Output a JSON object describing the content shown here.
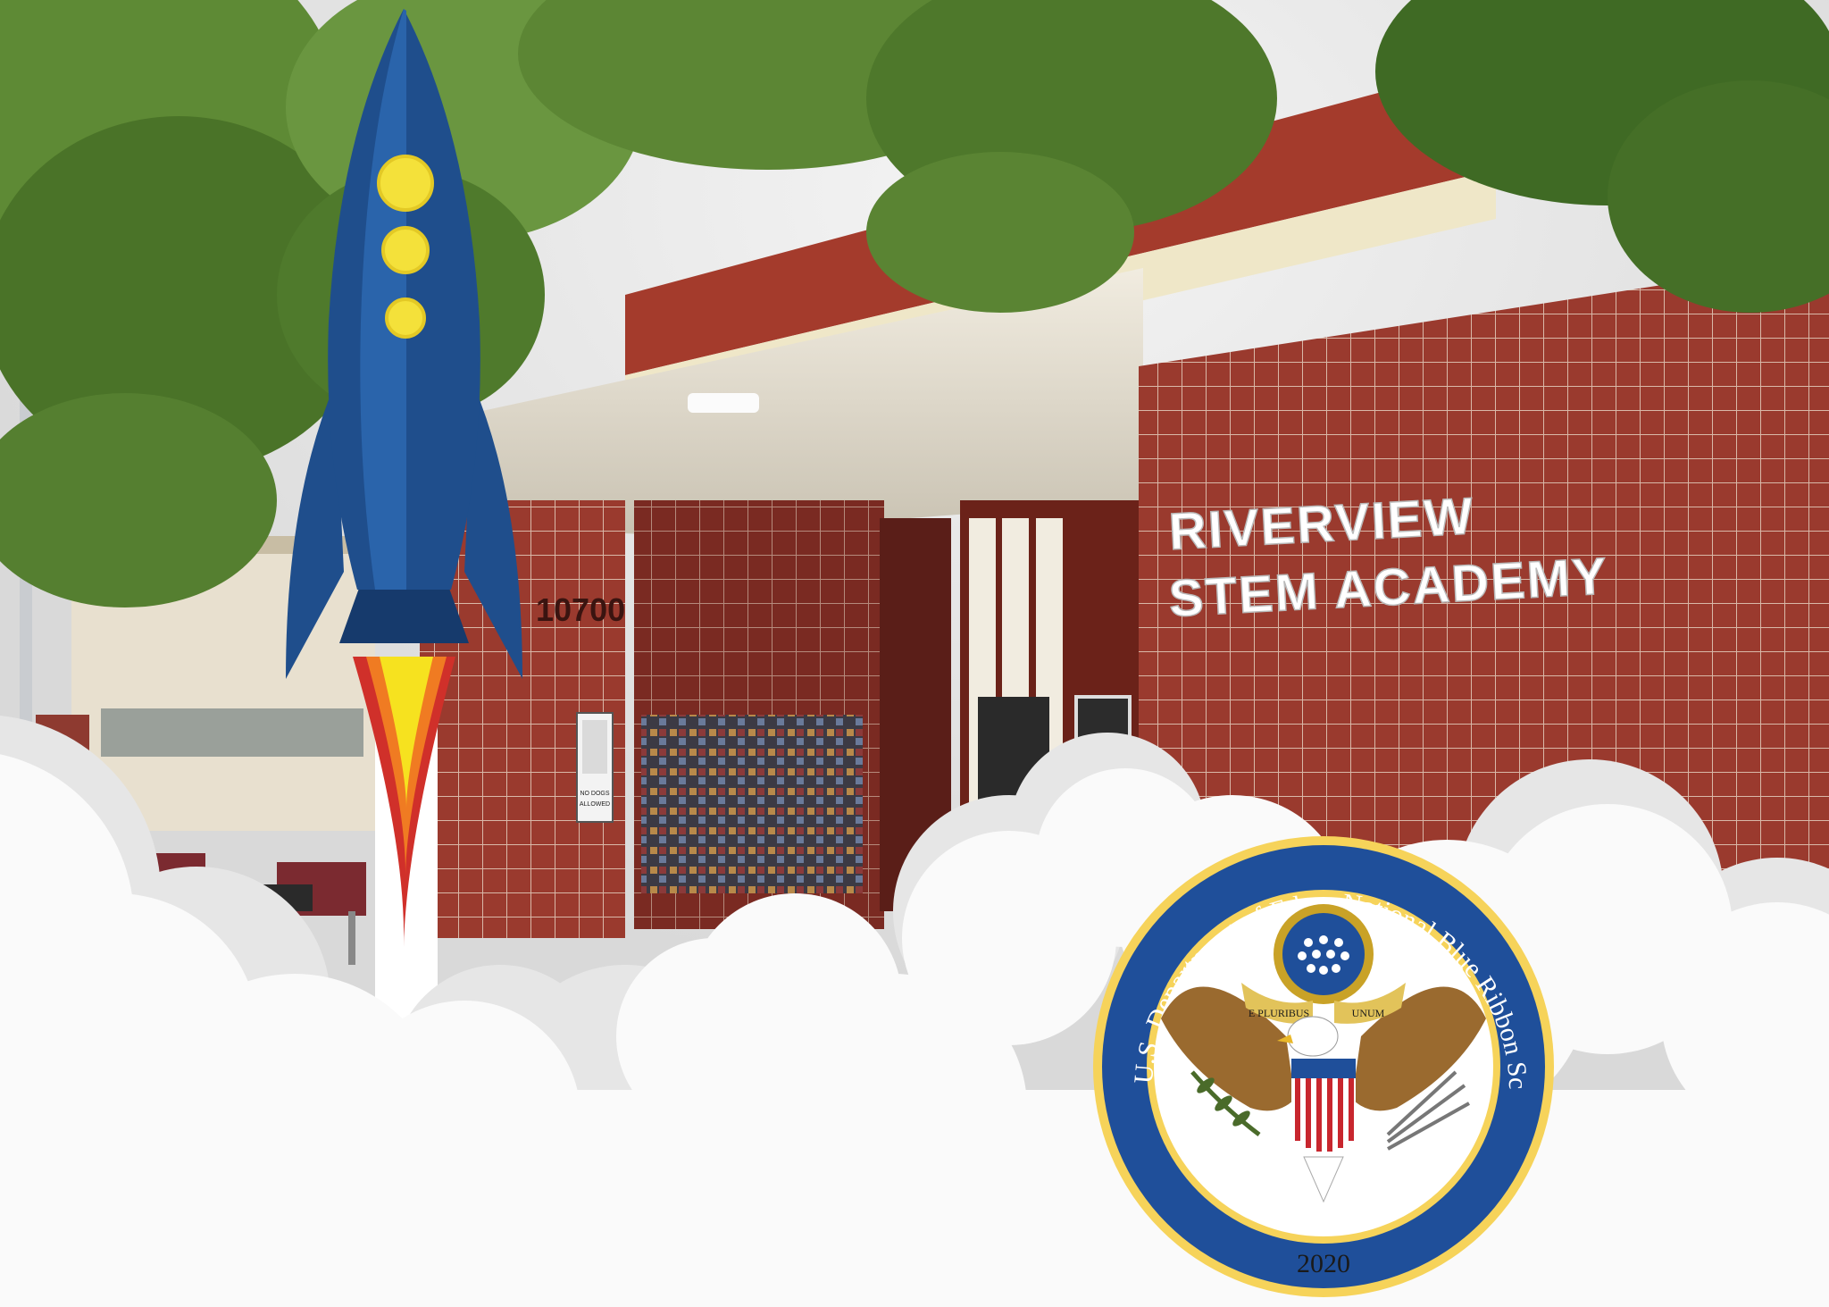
{
  "building": {
    "sign_line_1": "RIVERVIEW",
    "sign_line_2": "STEM ACADEMY",
    "address_number": "10700",
    "door_sign_line_1": "NO DOGS",
    "door_sign_line_2": "ALLOWED"
  },
  "seal": {
    "ring_text_left": "U.S. Department of Education",
    "ring_text_right": "National Blue Ribbon School",
    "motto_left": "E PLURIBUS",
    "motto_right": "UNUM",
    "year": "2020"
  },
  "colors": {
    "brick": "#9a3a2e",
    "seal_blue": "#1f4f9a",
    "seal_gold": "#c9a227",
    "rocket_body": "#1f4e8c",
    "rocket_window": "#f4e13a",
    "flame_red": "#d0302a",
    "flame_orange": "#f07b22",
    "flame_yellow": "#f6e21f",
    "foliage": "#4f7a2c"
  },
  "icons": {
    "rocket": "rocket-icon",
    "seal": "eagle-seal-icon",
    "clouds": "cloud-icon"
  }
}
